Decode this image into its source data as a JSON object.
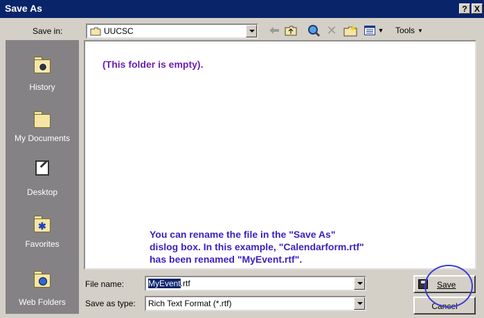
{
  "window": {
    "title": "Save As",
    "help_glyph": "?",
    "close_glyph": "X"
  },
  "toolbar": {
    "save_in_label": "Save in:",
    "save_in_value": "UUCSC",
    "tools_label": "Tools",
    "icons": [
      "back-arrow-icon",
      "up-folder-icon",
      "search-web-icon",
      "delete-icon",
      "new-folder-icon",
      "views-icon"
    ]
  },
  "places": [
    {
      "label": "History",
      "icon": "history-icon"
    },
    {
      "label": "My Documents",
      "icon": "my-documents-icon"
    },
    {
      "label": "Desktop",
      "icon": "desktop-icon"
    },
    {
      "label": "Favorites",
      "icon": "favorites-icon"
    },
    {
      "label": "Web Folders",
      "icon": "web-folders-icon"
    }
  ],
  "file_list": {
    "empty_message": "(This folder is empty).",
    "annotation_lines": [
      "You can rename the file in the \"Save As\"",
      "dislog box.  In this example, \"Calendarform.rtf\"",
      "has been renamed \"MyEvent.rtf\"."
    ]
  },
  "form": {
    "file_name_label": "File name:",
    "file_name_selected": "MyEvent",
    "file_name_rest": ".rtf",
    "save_type_label": "Save as type:",
    "save_type_value": "Rich Text Format (*.rtf)"
  },
  "buttons": {
    "save": "Save",
    "cancel": "Cancel"
  },
  "colors": {
    "titlebar": "#0a246a",
    "places_bg": "#848284",
    "annotation": "#3a1fc0",
    "empty_text": "#6a1fb0",
    "highlight_circle": "#3a3ad8"
  }
}
